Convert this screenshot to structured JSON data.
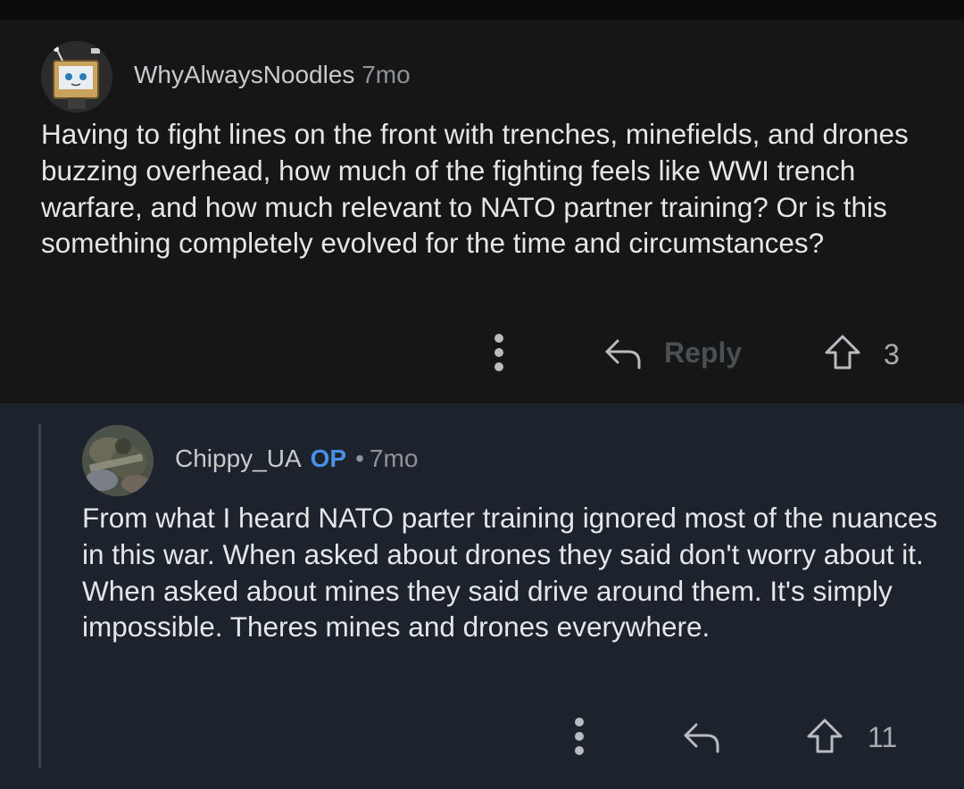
{
  "comments": [
    {
      "username": "WhyAlwaysNoodles",
      "age": "7mo",
      "is_op": false,
      "body": "Having to fight lines on the front with trenches, minefields, and drones buzzing overhead, how much of the fighting feels like WWI trench warfare, and how much relevant to NATO partner training? Or is this something completely evolved for the time and circumstances?",
      "actions": {
        "more_icon": "more-vertical-icon",
        "reply_label": "Reply",
        "reply_icon": "reply-arrow-icon",
        "upvote_icon": "upvote-arrow-icon",
        "upvote_count": "3"
      }
    },
    {
      "username": "Chippy_UA",
      "op_badge": "OP",
      "separator": "•",
      "age": "7mo",
      "is_op": true,
      "body": "From what I heard NATO parter training ignored most of the nuances in this war. When asked about drones they said don't worry about it. When asked about mines they said drive around them. It's simply impossible. Theres mines and drones everywhere.",
      "actions": {
        "more_icon": "more-vertical-icon",
        "reply_icon": "reply-arrow-icon",
        "upvote_icon": "upvote-arrow-icon",
        "upvote_count": "11"
      }
    }
  ],
  "colors": {
    "background_top": "#161616",
    "background_reply": "#1c232c",
    "op_badge": "#4a90e2",
    "text": "#e4e6e8",
    "muted": "#8e949a"
  }
}
